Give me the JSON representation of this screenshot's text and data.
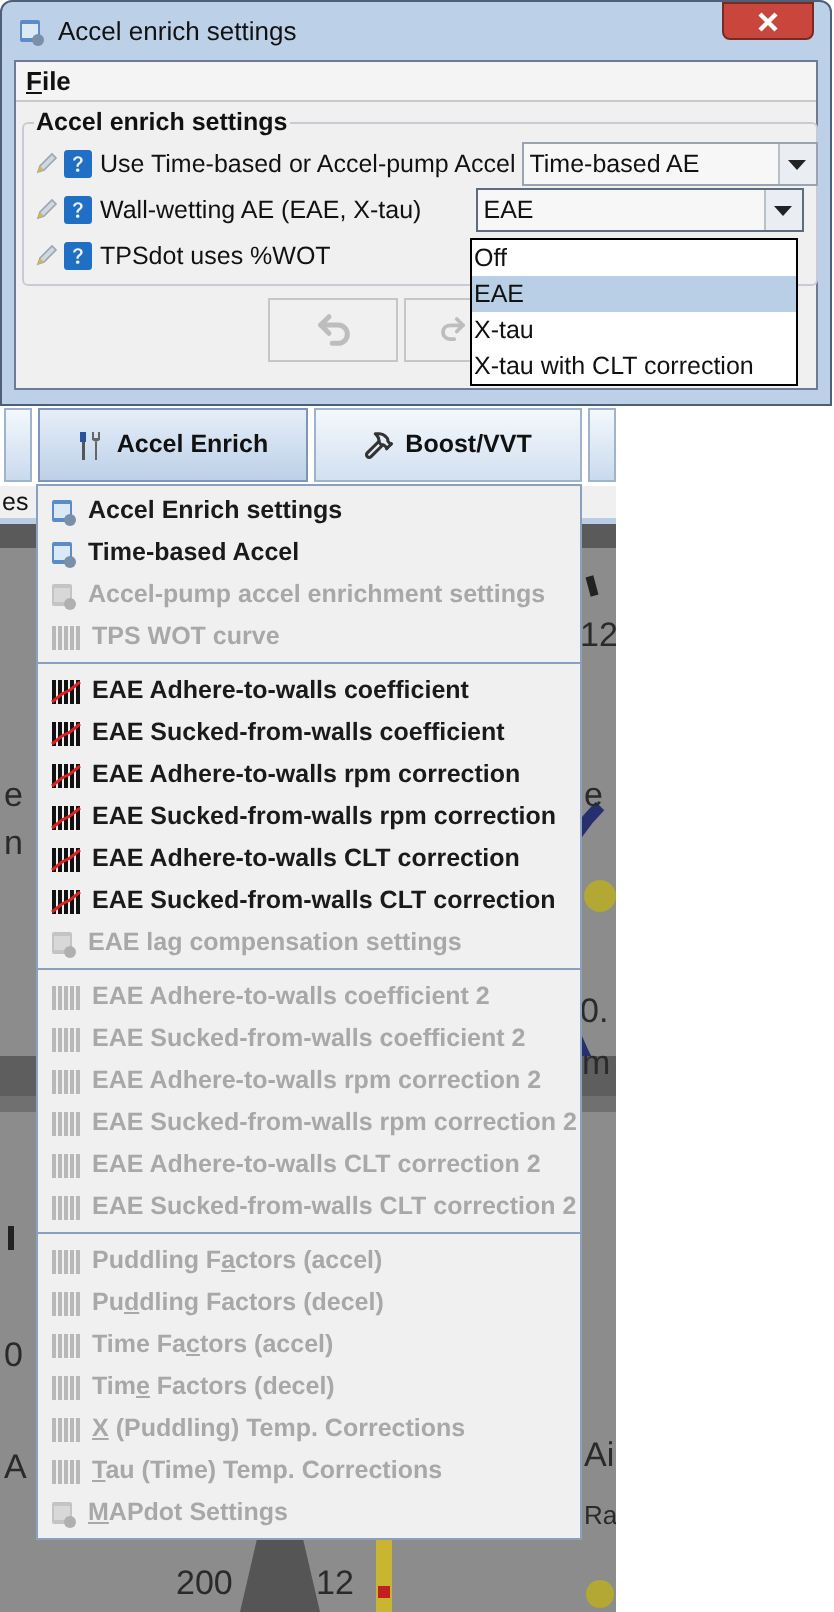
{
  "window": {
    "title": "Accel enrich settings"
  },
  "menu_bar": [
    {
      "label": "File"
    }
  ],
  "group": {
    "title": "Accel enrich settings",
    "rows": [
      {
        "label": "Use Time-based or Accel-pump Accel",
        "kind": "combo",
        "value": "Time-based AE",
        "open": false
      },
      {
        "label": "Wall-wetting AE (EAE, X-tau)",
        "kind": "combo",
        "value": "EAE",
        "open": true,
        "options": [
          {
            "label": "Off",
            "selected": false
          },
          {
            "label": "EAE",
            "selected": true
          },
          {
            "label": "X-tau",
            "selected": false
          },
          {
            "label": "X-tau with CLT correction",
            "selected": false
          }
        ]
      },
      {
        "label": "TPSdot uses %WOT",
        "kind": "plain"
      }
    ]
  },
  "buttons": [
    {
      "kind": "undo",
      "disabled": true
    },
    {
      "kind": "redo",
      "disabled": true
    }
  ],
  "toolbar": [
    {
      "label": "Accel Enrich",
      "selected": true
    },
    {
      "label": "Boost/VVT",
      "selected": false
    }
  ],
  "tab_strip_text": "es",
  "gauge_labels": [
    "12",
    "e",
    "0.",
    "m",
    "Ai",
    "Ra",
    "e",
    "n",
    "0",
    "A",
    "200",
    "12"
  ],
  "menu_sections": [
    [
      {
        "label": "Accel Enrich settings",
        "kind": "dialog",
        "disabled": false
      },
      {
        "label": "Time-based Accel",
        "kind": "dialog",
        "disabled": false
      },
      {
        "label": "Accel-pump accel enrichment settings",
        "kind": "dialog",
        "disabled": true
      },
      {
        "label": "TPS WOT curve",
        "kind": "table",
        "disabled": true
      }
    ],
    [
      {
        "label": "EAE Adhere-to-walls coefficient",
        "kind": "table",
        "disabled": false
      },
      {
        "label": "EAE Sucked-from-walls coefficient",
        "kind": "table",
        "disabled": false
      },
      {
        "label": "EAE Adhere-to-walls rpm correction",
        "kind": "table",
        "disabled": false
      },
      {
        "label": "EAE Sucked-from-walls rpm correction",
        "kind": "table",
        "disabled": false
      },
      {
        "label": "EAE Adhere-to-walls CLT correction",
        "kind": "table",
        "disabled": false
      },
      {
        "label": "EAE Sucked-from-walls CLT correction",
        "kind": "table",
        "disabled": false
      },
      {
        "label": "EAE lag compensation settings",
        "kind": "dialog",
        "disabled": true
      }
    ],
    [
      {
        "label": "EAE Adhere-to-walls coefficient 2",
        "kind": "table",
        "disabled": true
      },
      {
        "label": "EAE Sucked-from-walls coefficient 2",
        "kind": "table",
        "disabled": true
      },
      {
        "label": "EAE Adhere-to-walls rpm correction 2",
        "kind": "table",
        "disabled": true
      },
      {
        "label": "EAE Sucked-from-walls rpm correction 2",
        "kind": "table",
        "disabled": true
      },
      {
        "label": "EAE Adhere-to-walls CLT correction 2",
        "kind": "table",
        "disabled": true
      },
      {
        "label": "EAE Sucked-from-walls CLT correction 2",
        "kind": "table",
        "disabled": true
      }
    ],
    [
      {
        "before": "Puddling F",
        "key": "a",
        "after": "ctors (accel)",
        "kind": "table",
        "disabled": true
      },
      {
        "before": "Pu",
        "key": "d",
        "after": "dling Factors (decel)",
        "kind": "table",
        "disabled": true
      },
      {
        "before": "Time Fa",
        "key": "c",
        "after": "tors (accel)",
        "kind": "table",
        "disabled": true
      },
      {
        "before": "Tim",
        "key": "e",
        "after": " Factors (decel)",
        "kind": "table",
        "disabled": true
      },
      {
        "key": "X",
        "after": " (Puddling) Temp. Corrections",
        "kind": "table",
        "disabled": true
      },
      {
        "key": "T",
        "after": "au (Time) Temp. Corrections",
        "kind": "table",
        "disabled": true
      },
      {
        "key": "M",
        "after": "APdot Settings",
        "kind": "dialog",
        "disabled": true
      }
    ]
  ]
}
